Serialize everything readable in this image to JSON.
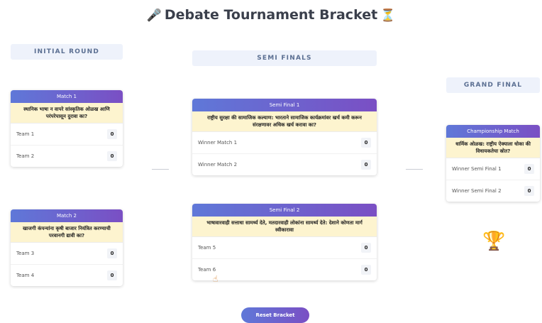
{
  "header": {
    "title": "Debate Tournament Bracket",
    "left_icon": "microphone-icon",
    "right_icon": "hourglass-icon"
  },
  "rounds": {
    "initial": "INITIAL ROUND",
    "semi": "SEMI FINALS",
    "final": "GRAND FINAL"
  },
  "matches": {
    "m1": {
      "title": "Match 1",
      "topic": "स्थानिक भाषा न वापरे सांस्कृतिक ओळख आणि परंपरेपासून दुरावा का?",
      "teams": [
        {
          "name": "Team 1",
          "score": "0"
        },
        {
          "name": "Team 2",
          "score": "0"
        }
      ]
    },
    "m2": {
      "title": "Match 2",
      "topic": "खाजगी कंपन्यांना कृषी बाजार नियंत्रित करण्याची परवानगी द्यावी का?",
      "teams": [
        {
          "name": "Team 3",
          "score": "0"
        },
        {
          "name": "Team 4",
          "score": "0"
        }
      ]
    },
    "s1": {
      "title": "Semi Final 1",
      "topic": "राष्ट्रीय सुरक्षा की सामाजिक कल्याण: भारताने सामाजिक कार्यक्रमांवर खर्च कमी करून संरक्षणावर अधिक खर्च करावा का?",
      "teams": [
        {
          "name": "Winner Match 1",
          "score": "0"
        },
        {
          "name": "Winner Match 2",
          "score": "0"
        }
      ]
    },
    "s2": {
      "title": "Semi Final 2",
      "topic": "भाषावारवाही सत्ताधा सामर्थ्य देते, मतदारवाही लोकांना सामर्थ्य देते: देशाने कोणता मार्ग स्वीकारावा",
      "teams": [
        {
          "name": "Team 5",
          "score": "0"
        },
        {
          "name": "Team 6",
          "score": "0"
        }
      ]
    },
    "final": {
      "title": "Championship Match",
      "topic": "धार्मिक ओळख: राष्ट्रीय ऐक्याला धोका की विधायकतेचा स्रोत?",
      "teams": [
        {
          "name": "Winner Semi Final 1",
          "score": "0"
        },
        {
          "name": "Winner Semi Final 2",
          "score": "0"
        }
      ]
    }
  },
  "trophy_icon": "trophy-icon",
  "reset_label": "Reset Bracket",
  "colors": {
    "header_gradient_start": "#5f78d8",
    "header_gradient_end": "#7a4fc4",
    "topic_bg": "#fdf4cf",
    "round_label_bg": "#eef2fb"
  }
}
